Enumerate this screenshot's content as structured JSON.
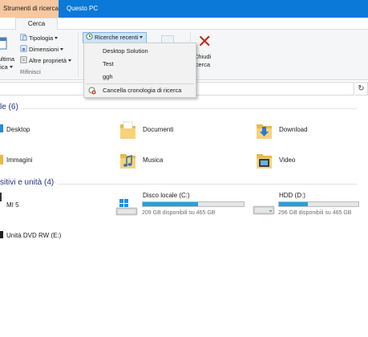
{
  "titlebar": {
    "context_tab": "Strumenti di ricerca",
    "title": "Questo PC"
  },
  "ribbon": {
    "active_tab": "Cerca",
    "last_modified_label_line1": "ultima",
    "last_modified_label_line2": "fica",
    "type_label": "Tipologia",
    "size_label": "Dimensioni",
    "other_props_label": "Altre proprietà",
    "group_label": "Rifinisci",
    "recent_searches_label": "Ricerche recenti",
    "close_label_line1": "Chiudi",
    "close_label_line2": "icerca"
  },
  "recent_dropdown": {
    "items": [
      "Desktop Solution",
      "Test",
      "ggh"
    ],
    "clear_history": "Cancella cronologia di ricerca"
  },
  "address": {
    "refresh_glyph": "↻"
  },
  "folders_section": {
    "title": "le (6)",
    "items": [
      {
        "label": "Desktop",
        "icon": "desktop-icon"
      },
      {
        "label": "Documenti",
        "icon": "documents-folder-icon"
      },
      {
        "label": "Download",
        "icon": "download-folder-icon"
      },
      {
        "label": "Immagini",
        "icon": "pictures-folder-icon"
      },
      {
        "label": "Musica",
        "icon": "music-folder-icon"
      },
      {
        "label": "Video",
        "icon": "video-folder-icon"
      }
    ]
  },
  "devices_section": {
    "title": "sitivi e unità (4)",
    "items": [
      {
        "label": "MI 5",
        "icon": "phone-icon"
      },
      {
        "label": "Disco locale (C:)",
        "info": "209 GB disponibili su 465 GB",
        "used_fraction": 0.55,
        "icon": "windows-drive-icon"
      },
      {
        "label": "HDD (D:)",
        "info": "296 GB disponibili su 465 GB",
        "used_fraction": 0.36,
        "icon": "hard-drive-icon"
      },
      {
        "label": "Unità DVD RW (E:)",
        "icon": "dvd-drive-icon"
      }
    ]
  },
  "colors": {
    "titlebar": "#0a79d8",
    "context_tab": "#f7c8a0",
    "section_title": "#1e3287",
    "drive_fill": "#26a0da",
    "close_x": "#c42b1c"
  }
}
